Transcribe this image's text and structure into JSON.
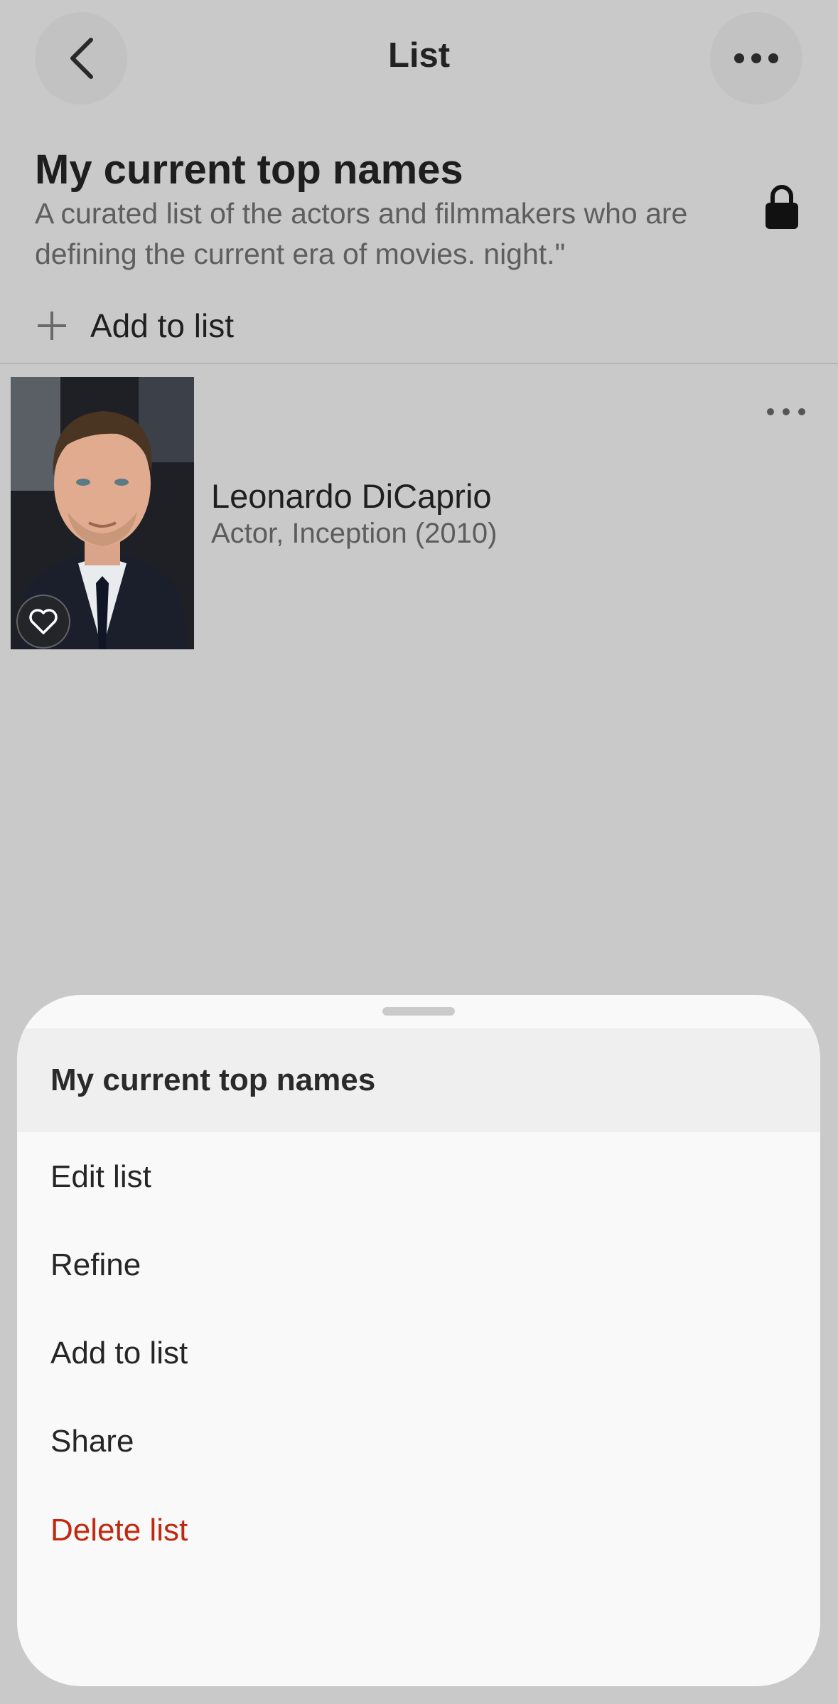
{
  "header": {
    "title": "List",
    "back_icon": "chevron-left-icon",
    "more_icon": "more-horizontal-icon"
  },
  "list": {
    "title": "My current top names",
    "description": "A curated list of the actors and filmmakers who are defining the current era of movies. night.\"",
    "privacy_icon": "lock-icon",
    "add_label": "Add to list"
  },
  "items": [
    {
      "name": "Leonardo DiCaprio",
      "subtitle": "Actor, Inception (2010)",
      "favorite_icon": "heart-outline-icon",
      "more_icon": "more-horizontal-icon"
    }
  ],
  "sheet": {
    "title": "My current top names",
    "actions": [
      {
        "label": "Edit list"
      },
      {
        "label": "Refine"
      },
      {
        "label": "Add to list"
      },
      {
        "label": "Share"
      },
      {
        "label": "Delete list",
        "color": "#c0290f"
      }
    ]
  },
  "colors": {
    "background": "#c9c9c9",
    "sheet": "#f9f9f9",
    "danger": "#c0290f"
  }
}
